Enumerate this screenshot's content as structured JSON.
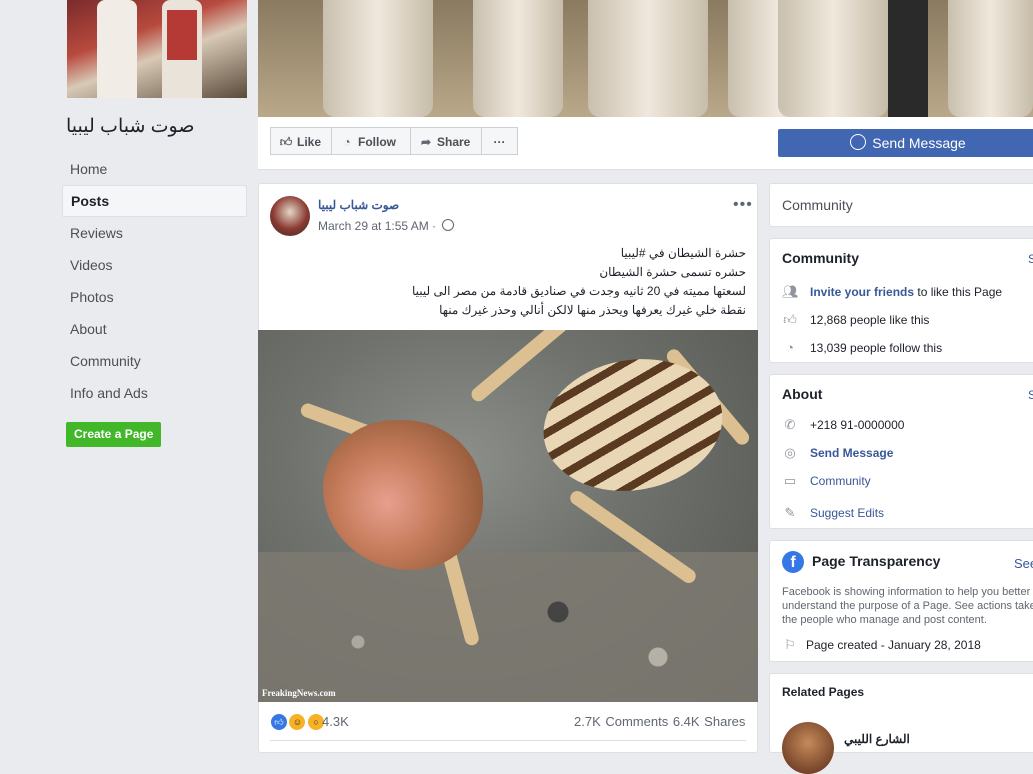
{
  "page": {
    "name": "صوت شباب ليبيا",
    "create_page_label": "Create a Page"
  },
  "nav": {
    "items": [
      {
        "label": "Home"
      },
      {
        "label": "Posts"
      },
      {
        "label": "Reviews"
      },
      {
        "label": "Videos"
      },
      {
        "label": "Photos"
      },
      {
        "label": "About"
      },
      {
        "label": "Community"
      },
      {
        "label": "Info and Ads"
      }
    ],
    "active": "Posts"
  },
  "actions": {
    "like": "Like",
    "follow": "Follow",
    "share": "Share",
    "more": "···",
    "send_message": "Send Message"
  },
  "post": {
    "author": "صوت شباب ليبيا",
    "time": "March 29 at 1:55 AM ·",
    "more": "•••",
    "lines": [
      "حشرة الشيطان في #ليبيا",
      "حشره تسمى حشرة الشيطان",
      "لسعتها مميته في 20 ثانيه وجدت في صناديق قادمة من مصر الى ليبيا",
      "نقطة خلي غيرك يعرفها ويحذر منها لالكن أنالي وحذر غيرك منها"
    ],
    "watermark": "FreakingNews.com",
    "reaction_count": "4.3K",
    "comments": "2.7K Comments",
    "shares": "6.4K Shares"
  },
  "sidebar": {
    "community_header": "Community",
    "community_card": {
      "title": "Community",
      "see_all": "S",
      "invite_bold": "Invite your friends",
      "invite_rest": " to like this Page",
      "likes": "12,868 people like this",
      "follows": "13,039 people follow this"
    },
    "about_card": {
      "title": "About",
      "see_all": "S",
      "phone": "+218 91-0000000",
      "send_message": "Send Message",
      "category": "Community",
      "suggest_edits": "Suggest Edits"
    },
    "transparency": {
      "title": "Page Transparency",
      "see_all": "See",
      "body_1": "Facebook is showing information to help you better",
      "body_2": "understand the purpose of a Page. See actions take",
      "body_3": "the people who manage and post content.",
      "created": "Page created - January 28, 2018"
    },
    "related": {
      "title": "Related Pages",
      "first_name": "الشارع الليبي"
    }
  },
  "colors": {
    "brand_blue": "#4267b2",
    "link_blue": "#385898",
    "green": "#42b72a",
    "page_bg": "#e9ebee"
  }
}
